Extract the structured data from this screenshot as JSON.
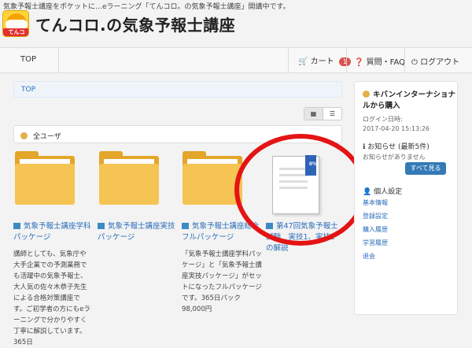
{
  "header": {
    "tagline": "気象予報士講座をポケットに…eラーニング「てんコロ。の気象予報士講座」開講中です。",
    "logo_tag": "てんコロ。",
    "site_title": "てんコロ.の気象予報士講座"
  },
  "nav": {
    "top": "TOP",
    "cart": "カート",
    "cart_count": "1",
    "faq": "質問・FAQ",
    "logout": "ログアウト"
  },
  "breadcrumb": {
    "top": "TOP"
  },
  "view_toggle": {
    "grid": "▦",
    "list": "☰"
  },
  "scope": {
    "label": "全ユーザ"
  },
  "courses": [
    {
      "title": "気象予報士講座学科パッケージ",
      "description": "講師としても、気象庁や大手企業での予測業務でも活躍中の気象予報士、大人気の佐々木恭子先生による合格対策講座です。ご初学者の方にもeラーニングで分かりやすく丁寧に解説しています。365日"
    },
    {
      "title": "気象予報士講座実技パッケージ",
      "description": ""
    },
    {
      "title": "気象予報士講座総合フルパッケージ",
      "description": "「気象予報士講座学科パッケージ」と「気象予報士講座実技パッケージ」がセットになったフルパッケージです。365日パック　98,000円"
    },
    {
      "title": "第47回気象予報士試験　実技1、実技2　の解説",
      "description": "",
      "progress": "0%"
    }
  ],
  "sidebar": {
    "user_name": "キバンインターナショナルから購入",
    "login_label": "ログイン日時:",
    "login_time": "2017-04-20 15:13:26",
    "notice_heading": "お知らせ (最新5件)",
    "notice_empty": "お知らせがありません",
    "view_all": "すべて見る",
    "settings_heading": "個人設定",
    "links": [
      "基本情報",
      "登録設定",
      "購入履歴",
      "学習履歴",
      "退会"
    ]
  },
  "colors": {
    "accent": "#2a6ebb",
    "highlight_circle": "#e41414",
    "button": "#337ab7",
    "badge": "#d9534f"
  }
}
